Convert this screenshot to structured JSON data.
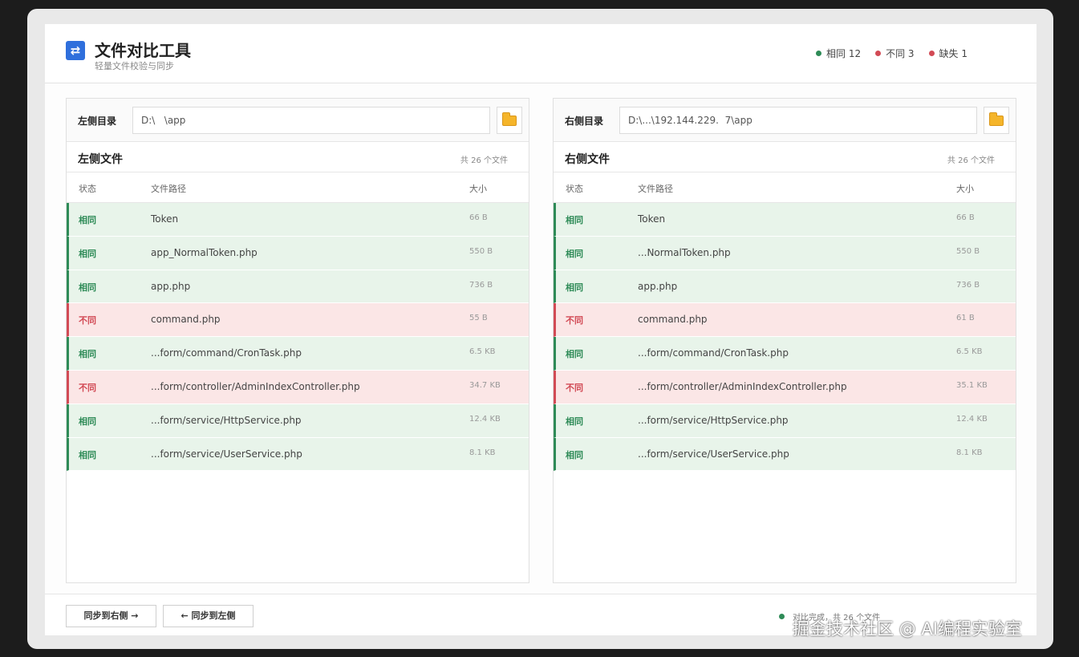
{
  "header": {
    "title": "文件对比工具",
    "subtitle": "轻量文件校验与同步",
    "logo_glyph": "⇄",
    "stats": [
      {
        "label": "相同 12",
        "color": "#2e8b57"
      },
      {
        "label": "不同 3",
        "color": "#d24a55"
      },
      {
        "label": "缺失 1",
        "color": "#d24a55"
      }
    ]
  },
  "left": {
    "dir_label": "左侧目录",
    "dir_value": "D:\\   \\app",
    "files_title": "左侧文件",
    "file_count": "共 26 个文件",
    "columns": {
      "status": "状态",
      "path": "文件路径",
      "size": "大小"
    },
    "rows": [
      {
        "status": "相同",
        "kind": "same",
        "path": "Token",
        "size": "66 B"
      },
      {
        "status": "相同",
        "kind": "same",
        "path": "app_NormalToken.php",
        "size": "550 B"
      },
      {
        "status": "相同",
        "kind": "same",
        "path": "app.php",
        "size": "736 B"
      },
      {
        "status": "不同",
        "kind": "diff",
        "path": "command.php",
        "size": "55 B"
      },
      {
        "status": "相同",
        "kind": "same",
        "path": "...form/command/CronTask.php",
        "size": "6.5 KB"
      },
      {
        "status": "不同",
        "kind": "diff",
        "path": "...form/controller/AdminIndexController.php",
        "size": "34.7 KB"
      },
      {
        "status": "相同",
        "kind": "same",
        "path": "...form/service/HttpService.php",
        "size": "12.4 KB"
      },
      {
        "status": "相同",
        "kind": "same",
        "path": "...form/service/UserService.php",
        "size": "8.1 KB"
      }
    ]
  },
  "right": {
    "dir_label": "右侧目录",
    "dir_value": "D:\\...\\192.144.229.  7\\app",
    "files_title": "右侧文件",
    "file_count": "共 26 个文件",
    "columns": {
      "status": "状态",
      "path": "文件路径",
      "size": "大小"
    },
    "rows": [
      {
        "status": "相同",
        "kind": "same",
        "path": "Token",
        "size": "66 B"
      },
      {
        "status": "相同",
        "kind": "same",
        "path": "...NormalToken.php",
        "size": "550 B"
      },
      {
        "status": "相同",
        "kind": "same",
        "path": "app.php",
        "size": "736 B"
      },
      {
        "status": "不同",
        "kind": "diff",
        "path": "command.php",
        "size": "61 B"
      },
      {
        "status": "相同",
        "kind": "same",
        "path": "...form/command/CronTask.php",
        "size": "6.5 KB"
      },
      {
        "status": "不同",
        "kind": "diff",
        "path": "...form/controller/AdminIndexController.php",
        "size": "35.1 KB"
      },
      {
        "status": "相同",
        "kind": "same",
        "path": "...form/service/HttpService.php",
        "size": "12.4 KB"
      },
      {
        "status": "相同",
        "kind": "same",
        "path": "...form/service/UserService.php",
        "size": "8.1 KB"
      }
    ]
  },
  "footer": {
    "sync_right_label": "同步到右侧 →",
    "sync_left_label": "← 同步到左侧",
    "status_text": "对比完成，共 26 个文件",
    "status_color": "#2e8b57"
  },
  "watermark": "掘金技术社区 @ AI编程实验室"
}
